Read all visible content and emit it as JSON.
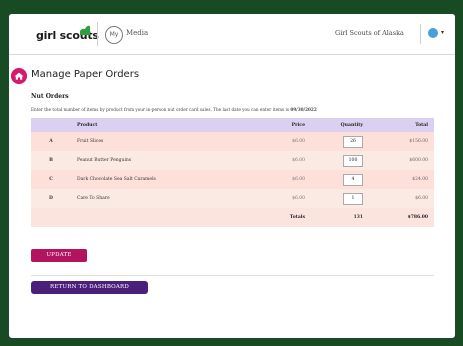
{
  "header": {
    "logo_text": "girl scouts",
    "my_badge": "My",
    "media_label": "Media",
    "council_name": "Girl Scouts of Alaska",
    "menu_caret": "▾"
  },
  "page": {
    "title": "Manage Paper Orders",
    "section_title": "Nut Orders",
    "instructions_prefix": "Enter the total number of items by product from your in-person nut order card sales. The last date you can enter items is ",
    "deadline": "09/30/2022"
  },
  "table": {
    "headers": [
      "",
      "Product",
      "Price",
      "Quantity",
      "Total"
    ],
    "rows": [
      {
        "letter": "A",
        "product": "Fruit Slices",
        "price": "$6.00",
        "quantity": "26",
        "total": "$156.00"
      },
      {
        "letter": "B",
        "product": "Peanut Butter Penguins",
        "price": "$6.00",
        "quantity": "100",
        "total": "$600.00"
      },
      {
        "letter": "C",
        "product": "Dark Chocolate Sea Salt Caramels",
        "price": "$6.00",
        "quantity": "4",
        "total": "$24.00"
      },
      {
        "letter": "D",
        "product": "Care To Share",
        "price": "$6.00",
        "quantity": "1",
        "total": "$6.00"
      }
    ],
    "totals_label": "Totals",
    "totals_quantity": "131",
    "totals_amount": "$786.00"
  },
  "buttons": {
    "update_label": "UPDATE",
    "return_label": "RETURN TO DASHBOARD"
  },
  "colors": {
    "brand_green": "#184a23",
    "header_purple": "#dcd0f2",
    "row_pink": "#fce0d9",
    "update_magenta": "#b3145f",
    "return_purple": "#4b207a",
    "home_icon_pink": "#d61a6f"
  },
  "icons": {
    "logo": "trefoil-icon",
    "home": "home-icon",
    "globe": "globe-icon"
  }
}
